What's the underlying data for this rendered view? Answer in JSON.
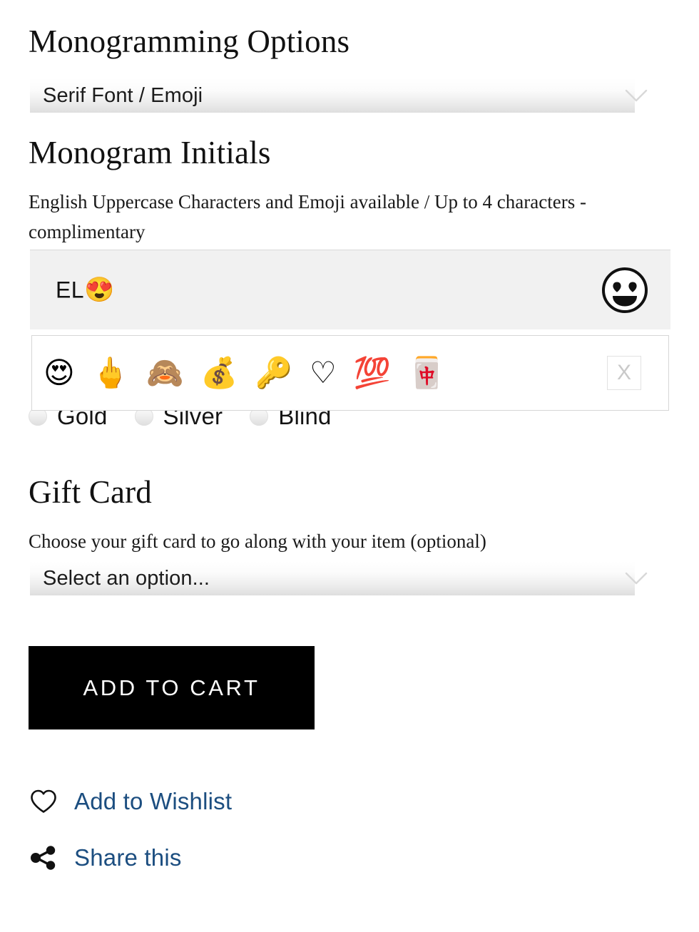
{
  "monogramming": {
    "title": "Monogramming Options",
    "font_select": {
      "value": "Serif Font / Emoji",
      "chevron_icon": "chevron-down-icon"
    }
  },
  "initials": {
    "title": "Monogram Initials",
    "description": "English Uppercase Characters and Emoji available / Up to 4 characters - complimentary",
    "input": {
      "value_text": "EL",
      "value_emoji": "😍",
      "placeholder": "",
      "toggle_icon": "smiling-face-with-heart-eyes-icon"
    },
    "emoji_picker": {
      "close_label": "X",
      "emojis": [
        {
          "name": "smiling-face-with-heart-eyes",
          "glyph": "😍"
        },
        {
          "name": "middle-finger",
          "glyph": "🖕"
        },
        {
          "name": "see-no-evil-monkey",
          "glyph": "🙈"
        },
        {
          "name": "money-bag",
          "glyph": "💰"
        },
        {
          "name": "key",
          "glyph": "🔑"
        },
        {
          "name": "white-heart-outline",
          "glyph": "♡"
        },
        {
          "name": "hundred-points",
          "glyph": "💯"
        },
        {
          "name": "mahjong-red-dragon",
          "glyph": "🀄"
        }
      ]
    },
    "finish_options": [
      {
        "label": "Gold",
        "selected": false
      },
      {
        "label": "Silver",
        "selected": false
      },
      {
        "label": "Blind",
        "selected": false
      }
    ]
  },
  "gift_card": {
    "title": "Gift Card",
    "description": "Choose your gift card to go along with your item (optional)",
    "select": {
      "value": "Select an option...",
      "chevron_icon": "chevron-down-icon"
    }
  },
  "actions": {
    "add_to_cart_label": "ADD TO CART",
    "wishlist_label": "Add to Wishlist",
    "share_label": "Share this"
  },
  "colors": {
    "link": "#1c4e80",
    "button_bg": "#000000",
    "field_bg": "#f1f1f1"
  }
}
